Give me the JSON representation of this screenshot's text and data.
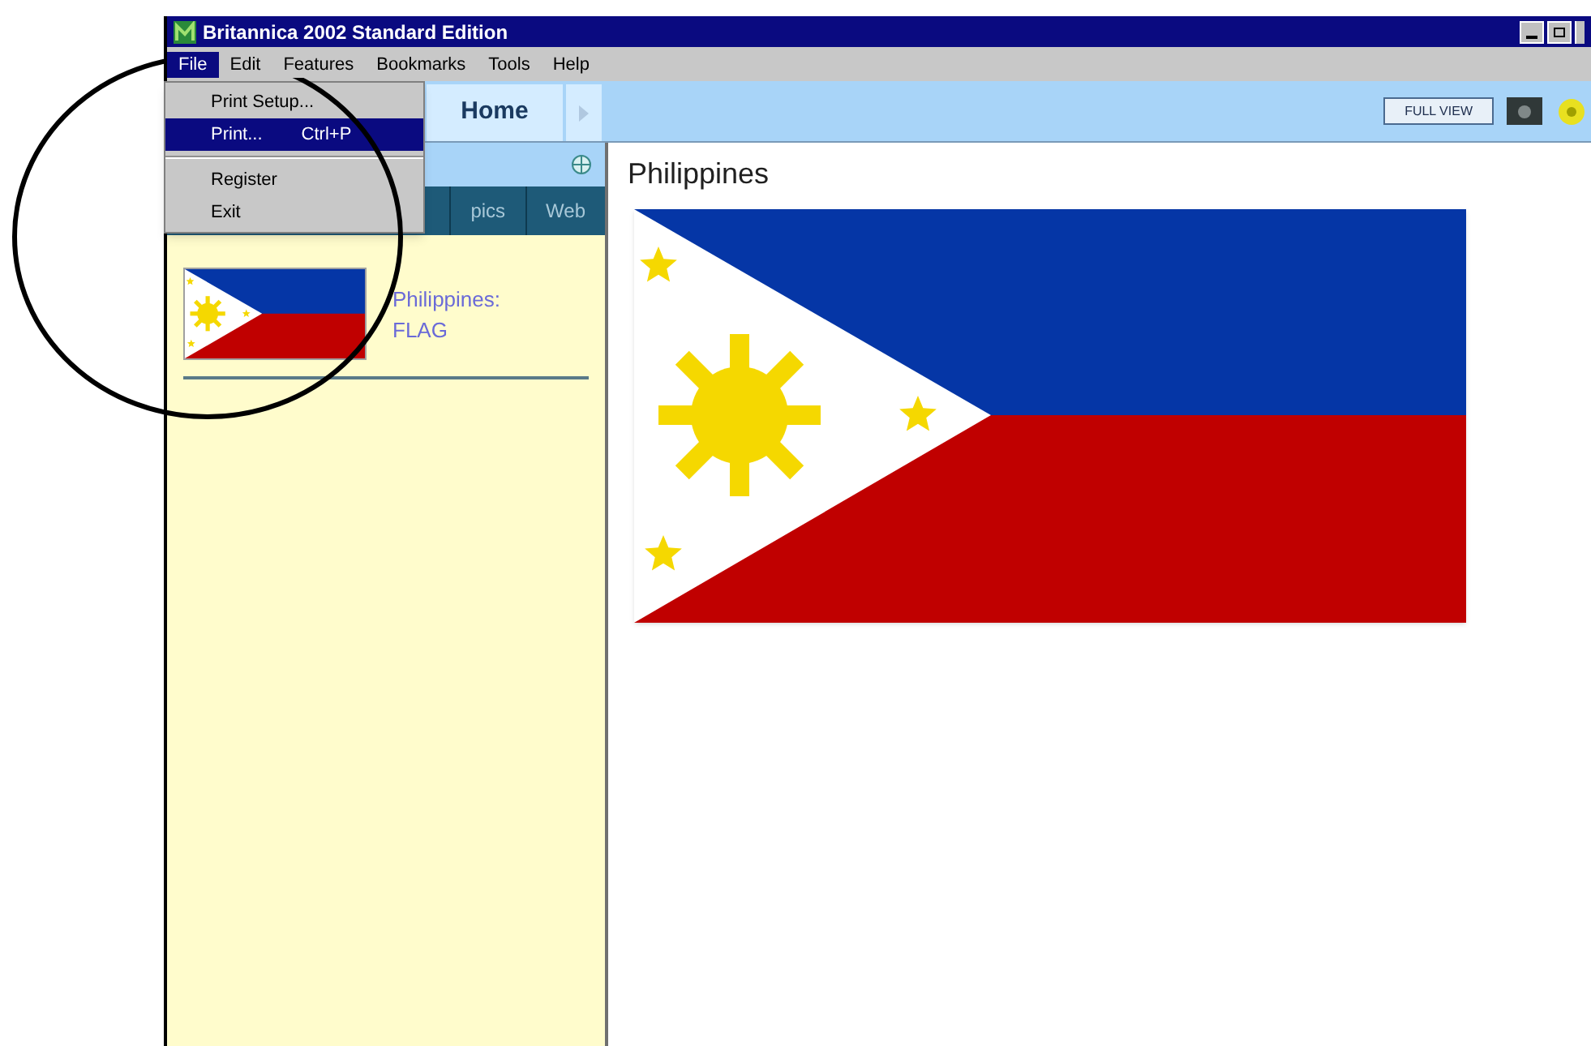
{
  "window": {
    "title": "Britannica 2002 Standard Edition"
  },
  "menu": [
    {
      "label": "File",
      "selected": true
    },
    {
      "label": "Edit",
      "selected": false
    },
    {
      "label": "Features",
      "selected": false
    },
    {
      "label": "Bookmarks",
      "selected": false
    },
    {
      "label": "Tools",
      "selected": false
    },
    {
      "label": "Help",
      "selected": false
    }
  ],
  "file_menu": [
    {
      "kind": "item",
      "label": "Print Setup...",
      "selected": false
    },
    {
      "kind": "item",
      "label": "Print...",
      "shortcut": "Ctrl+P",
      "selected": true
    },
    {
      "kind": "separator"
    },
    {
      "kind": "item",
      "label": "Register",
      "selected": false
    },
    {
      "kind": "item",
      "label": "Exit",
      "selected": false
    }
  ],
  "toolbar": {
    "home_tab": "Home",
    "full_view_button": "FULL VIEW"
  },
  "sidebar": {
    "tabs": [
      {
        "label": "pics",
        "selected": false
      },
      {
        "label": "Web",
        "selected": false
      }
    ],
    "results": [
      {
        "title": "Philippines: FLAG"
      }
    ]
  },
  "article": {
    "title": "Philippines"
  },
  "annotation": {
    "kind": "circle"
  }
}
